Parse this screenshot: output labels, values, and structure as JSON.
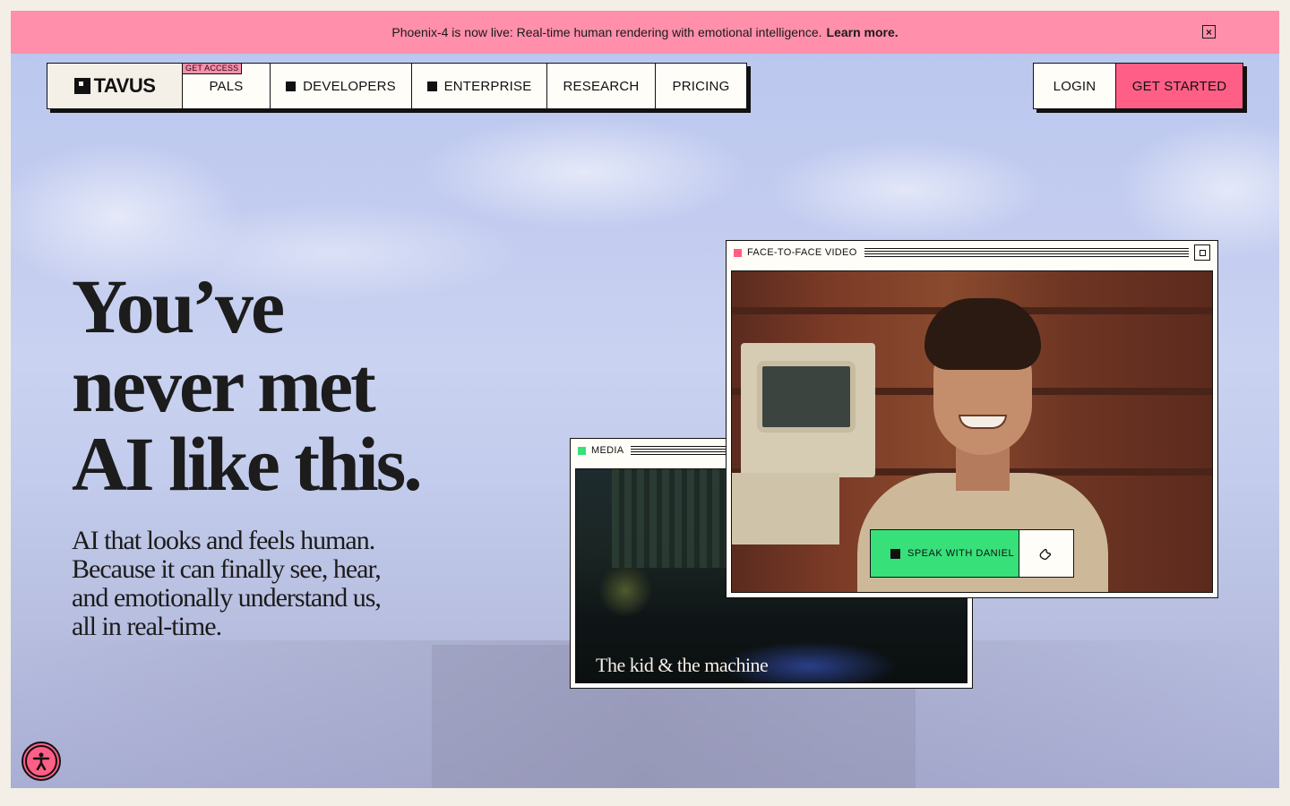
{
  "announcement": {
    "text": "Phoenix-4 is now live: Real-time human rendering with emotional intelligence.",
    "link": "Learn more.",
    "close_icon": "close-icon"
  },
  "nav": {
    "logo": "TAVUS",
    "items": [
      {
        "label": "PALS",
        "badge": "GET ACCESS"
      },
      {
        "label": "DEVELOPERS"
      },
      {
        "label": "ENTERPRISE"
      },
      {
        "label": "RESEARCH"
      },
      {
        "label": "PRICING"
      }
    ],
    "login": "LOGIN",
    "get_started": "GET STARTED"
  },
  "hero": {
    "title_lines": [
      "You’ve",
      "never met",
      "AI like this."
    ],
    "subtitle": "AI that looks and feels human. Because it can finally see, hear, and emotionally understand us, all in real-time."
  },
  "media_window": {
    "title": "MEDIA",
    "caption": "The kid & the machine"
  },
  "face_window": {
    "title": "FACE-TO-FACE VIDEO",
    "speak_button": "SPEAK WITH DANIEL"
  },
  "colors": {
    "accent_pink": "#ff5f87",
    "banner_pink": "#ff8fab",
    "speak_green": "#38e07a"
  }
}
